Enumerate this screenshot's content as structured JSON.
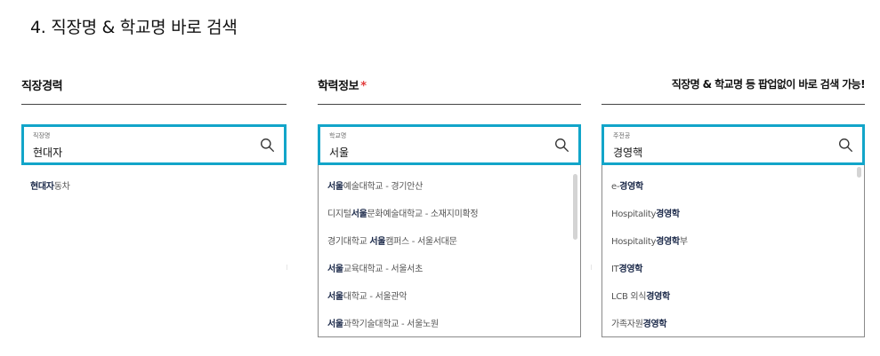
{
  "page_title": "4. 직장명 & 학교명 바로 검색",
  "columns": [
    {
      "header": "직장경력",
      "field_label": "직장명",
      "field_value": "현대자",
      "results": [
        {
          "match": "현대자",
          "rest": "동차"
        }
      ]
    },
    {
      "header": "학력정보",
      "required_star": "*",
      "field_label": "학교명",
      "field_value": "서울",
      "results": [
        {
          "pre": "",
          "match": "서울",
          "rest": "예술대학교 - 경기안산"
        },
        {
          "pre": "디지털",
          "match": "서울",
          "rest": "문화예술대학교 - 소재지미확정"
        },
        {
          "pre": "경기대학교 ",
          "match": "서울",
          "rest": "캠퍼스 - 서울서대문"
        },
        {
          "pre": "",
          "match": "서울",
          "rest": "교육대학교 - 서울서초"
        },
        {
          "pre": "",
          "match": "서울",
          "rest": "대학교 - 서울관악"
        },
        {
          "pre": "",
          "match": "서울",
          "rest": "과학기술대학교 - 서울노원"
        }
      ]
    },
    {
      "header": "직장명 & 학교명 등 팝업없이 바로 검색 가능!",
      "field_label": "주전공",
      "field_value": "경영핵",
      "results": [
        {
          "pre": "e-",
          "match": "경영학",
          "rest": ""
        },
        {
          "pre": "Hospitality",
          "match": "경영학",
          "rest": ""
        },
        {
          "pre": "Hospitality",
          "match": "경영학",
          "rest": "부"
        },
        {
          "pre": "IT",
          "match": "경영학",
          "rest": ""
        },
        {
          "pre": "LCB 외식",
          "match": "경영학",
          "rest": ""
        },
        {
          "pre": "가족자원",
          "match": "경영학",
          "rest": ""
        }
      ]
    }
  ],
  "icons": {
    "search": "search-icon"
  },
  "colors": {
    "accent": "#12a5c9",
    "match_text": "#1c2a4a",
    "required": "#e23b3b"
  }
}
